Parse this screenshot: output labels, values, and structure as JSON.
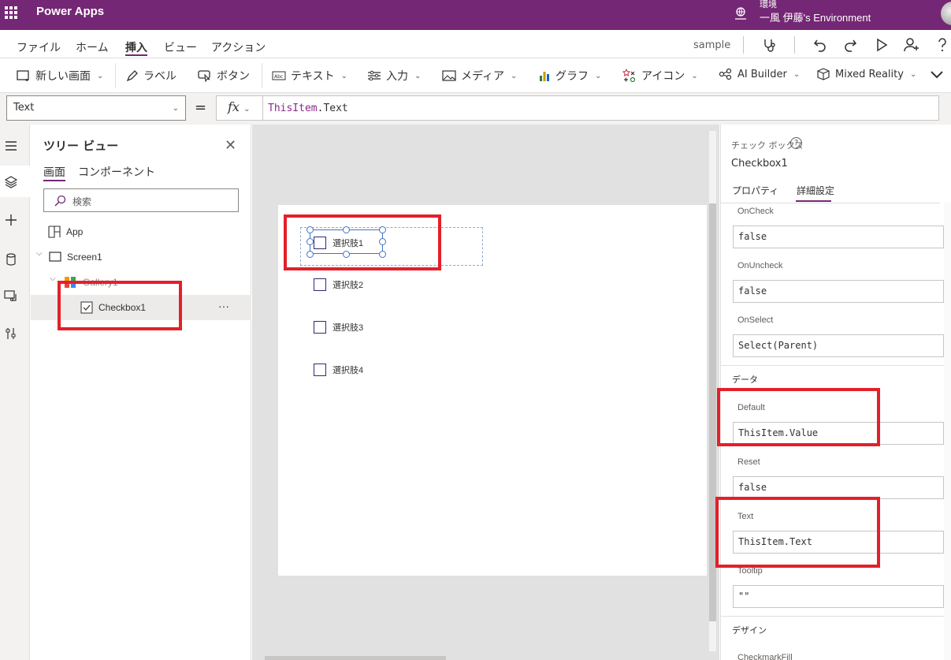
{
  "topbar": {
    "app_title": "Power Apps",
    "environment_label": "環境",
    "environment_name": "一風 伊藤's Environment"
  },
  "menu": {
    "items": [
      {
        "label": "ファイル"
      },
      {
        "label": "ホーム"
      },
      {
        "label": "挿入"
      },
      {
        "label": "ビュー"
      },
      {
        "label": "アクション"
      }
    ],
    "active_index": 2,
    "app_name": "sample"
  },
  "toolbar": {
    "items": [
      {
        "label": "新しい画面",
        "icon": "new-screen-icon"
      },
      {
        "label": "ラベル",
        "icon": "label-icon"
      },
      {
        "label": "ボタン",
        "icon": "button-icon"
      },
      {
        "label": "テキスト",
        "icon": "text-icon"
      },
      {
        "label": "入力",
        "icon": "input-icon"
      },
      {
        "label": "メディア",
        "icon": "media-icon"
      },
      {
        "label": "グラフ",
        "icon": "chart-icon"
      },
      {
        "label": "アイコン",
        "icon": "icons-icon"
      },
      {
        "label": "AI Builder",
        "icon": "ai-builder-icon"
      },
      {
        "label": "Mixed Reality",
        "icon": "mixed-reality-icon"
      }
    ]
  },
  "formula": {
    "property": "Text",
    "equals": "=",
    "fx": "fx",
    "keyword": "ThisItem",
    "rest": ".Text"
  },
  "tree": {
    "title": "ツリー ビュー",
    "tabs": [
      "画面",
      "コンポーネント"
    ],
    "search_placeholder": "検索",
    "app": "App",
    "screen": "Screen1",
    "gallery": "Gallery1",
    "checkbox": "Checkbox1",
    "more": "···"
  },
  "canvas": {
    "checkboxes": [
      "選択肢1",
      "選択肢2",
      "選択肢3",
      "選択肢4"
    ]
  },
  "props": {
    "type_label": "チェック ボックス",
    "control_name": "Checkbox1",
    "tabs": [
      "プロパティ",
      "詳細設定"
    ],
    "active_tab": 1,
    "fields": {
      "oncheck": {
        "label": "OnCheck",
        "value": "false"
      },
      "onuncheck": {
        "label": "OnUncheck",
        "value": "false"
      },
      "onselect": {
        "label": "OnSelect",
        "value": "Select(Parent)"
      },
      "default": {
        "label": "Default",
        "value": "ThisItem.Value"
      },
      "reset": {
        "label": "Reset",
        "value": "false"
      },
      "text": {
        "label": "Text",
        "value": "ThisItem.Text"
      },
      "tooltip": {
        "label": "Tooltip",
        "value": "\"\""
      },
      "checkmarkfill": {
        "label": "CheckmarkFill"
      }
    },
    "sections": {
      "data": "データ",
      "design": "デザイン"
    }
  },
  "colors": {
    "brand": "#742774",
    "highlight": "#e3202a",
    "selection": "#4472c4"
  }
}
